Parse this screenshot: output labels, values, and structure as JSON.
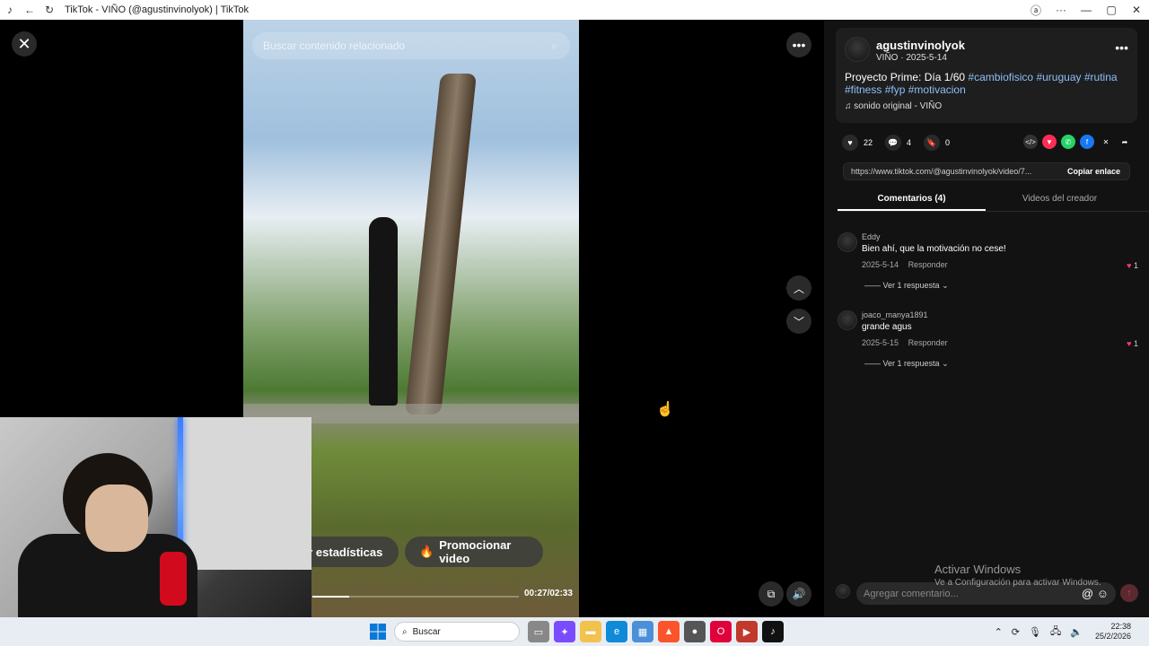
{
  "browser": {
    "tab_title": "TikTok - VIÑO (@agustinvinolyok) | TikTok"
  },
  "video": {
    "search_placeholder": "Buscar contenido relacionado",
    "stats_button": "er estadísticas",
    "promote_button": "Promocionar video",
    "time": "00:27/02:33",
    "progress": 0.18
  },
  "post": {
    "author": "agustinvinolyok",
    "subtitle": "VIÑO · 2025-5-14",
    "caption_text": "Proyecto Prime: Día 1/60",
    "tags": [
      "#cambiofisico",
      "#uruguay",
      "#rutina",
      "#fitness",
      "#fyp",
      "#motivacion"
    ],
    "music": "sonido original - VIÑO",
    "likes": "22",
    "comments": "4",
    "saves": "0",
    "link": "https://www.tiktok.com/@agustinvinolyok/video/7...",
    "copy_link": "Copiar enlace"
  },
  "tabs": [
    {
      "label": "Comentarios (4)"
    },
    {
      "label": "Videos del creador"
    }
  ],
  "comments": [
    {
      "user": "Eddy",
      "text": "Bien ahí, que la motivación no cese!",
      "date": "2025-5-14",
      "reply": "Responder",
      "likes": "1",
      "more": "Ver 1 respuesta"
    },
    {
      "user": "joaco_manya1891",
      "text": "grande agus",
      "date": "2025-5-15",
      "reply": "Responder",
      "likes": "1",
      "more": "Ver 1 respuesta"
    }
  ],
  "add_comment_placeholder": "Agregar comentario...",
  "watermark": {
    "title": "Activar Windows",
    "subtitle": "Ve a Configuración para activar Windows."
  },
  "taskbar": {
    "search_label": "Buscar",
    "time": "22:38",
    "date": "25/2/2026"
  },
  "colors": {
    "tag": "#8fbff5",
    "heart": "#ff3b6b",
    "panel_bg": "#121212"
  }
}
